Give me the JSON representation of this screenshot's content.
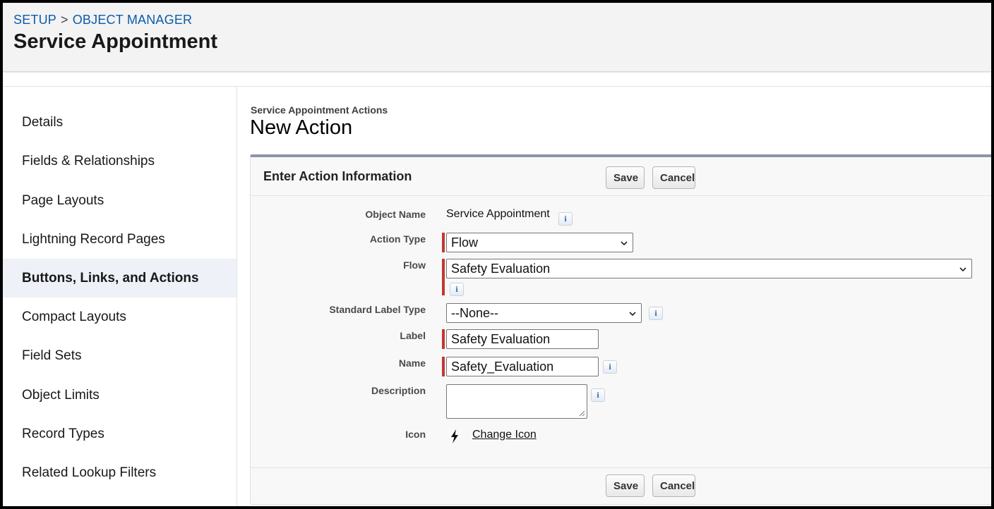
{
  "breadcrumb": {
    "setup": "SETUP",
    "separator": ">",
    "object_manager": "OBJECT MANAGER"
  },
  "page_title": "Service Appointment",
  "sidebar": {
    "items": [
      {
        "label": "Details"
      },
      {
        "label": "Fields & Relationships"
      },
      {
        "label": "Page Layouts"
      },
      {
        "label": "Lightning Record Pages"
      },
      {
        "label": "Buttons, Links, and Actions",
        "active": true
      },
      {
        "label": "Compact Layouts"
      },
      {
        "label": "Field Sets"
      },
      {
        "label": "Object Limits"
      },
      {
        "label": "Record Types"
      },
      {
        "label": "Related Lookup Filters"
      }
    ]
  },
  "main": {
    "subtitle": "Service Appointment Actions",
    "title": "New Action"
  },
  "panel": {
    "title": "Enter Action Information",
    "save_label": "Save",
    "cancel_label": "Cancel",
    "info_glyph": "i",
    "fields": {
      "object_name": {
        "label": "Object Name",
        "value": "Service Appointment"
      },
      "action_type": {
        "label": "Action Type",
        "value": "Flow"
      },
      "flow": {
        "label": "Flow",
        "value": "Safety Evaluation"
      },
      "standard_label_type": {
        "label": "Standard Label Type",
        "value": "--None--"
      },
      "label": {
        "label": "Label",
        "value": "Safety Evaluation"
      },
      "name": {
        "label": "Name",
        "value": "Safety_Evaluation"
      },
      "description": {
        "label": "Description",
        "value": ""
      },
      "icon": {
        "label": "Icon",
        "link": "Change Icon",
        "icon_name": "lightning-bolt-icon"
      }
    }
  },
  "colors": {
    "link": "#0b5cab",
    "required": "#c23934",
    "panel_border": "#8a96a5",
    "active_nav": "#eef1f8"
  }
}
